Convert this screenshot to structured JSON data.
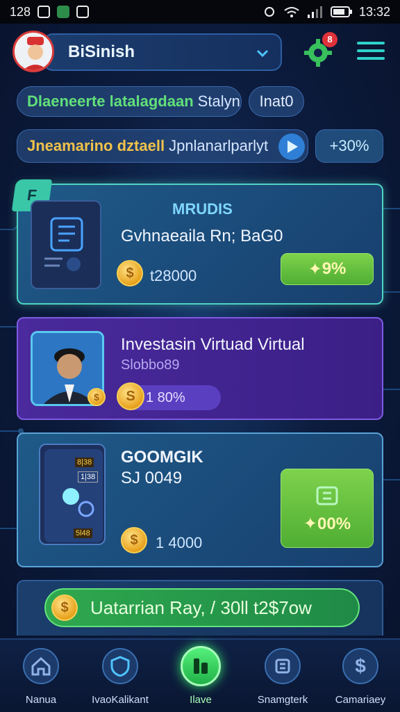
{
  "status_bar": {
    "time_left": "128",
    "time_right": "13:32"
  },
  "header": {
    "username": "BiSinish",
    "notification_count": "8"
  },
  "chips": {
    "row1_green": "Dlaeneerte latalagdaan",
    "row1_white": "Stalyn",
    "row1_badge": "Inat0",
    "row2_yellow": "Jneamarino dztaell",
    "row2_white": "Jpnlanarlparlyt",
    "row2_percent": "+30%"
  },
  "cards": [
    {
      "tag": "F",
      "title": "MRUDIS",
      "subtitle": "Gvhnaeaila Rn; BaG0",
      "value": "t28000",
      "percent": "9%"
    },
    {
      "title": "Investasin Virtuad Virtual",
      "subtitle": "Slobbo89",
      "value": "1 80%"
    },
    {
      "title": "GOOMGIK",
      "subtitle": "SJ 0049",
      "value": "1 4000",
      "thumb_labels": [
        "8|38",
        "1|38",
        "5l48"
      ],
      "percent": "00%"
    },
    {
      "button_label": "Uatarrian Ray, / 30ll t2$7ow"
    }
  ],
  "nav": [
    {
      "label": "Nanua",
      "icon": "home-icon"
    },
    {
      "label": "IvaoKalikant",
      "icon": "shield-icon"
    },
    {
      "label": "Ilave",
      "icon": "invest-icon",
      "active": true
    },
    {
      "label": "Snamgterk",
      "icon": "exchange-icon"
    },
    {
      "label": "Camariaey",
      "icon": "dollar-icon"
    }
  ],
  "colors": {
    "accent_green": "#4fae33",
    "accent_teal": "#39c7a8",
    "accent_purple": "#4a2a9c",
    "badge_red": "#e0323a"
  }
}
